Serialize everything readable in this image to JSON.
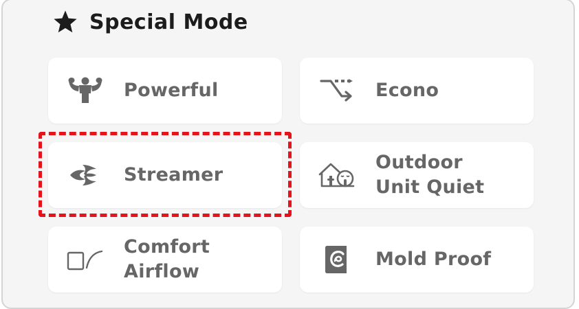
{
  "header": {
    "title": "Special Mode",
    "icon": "star-icon"
  },
  "modes": [
    {
      "id": "powerful",
      "label": "Powerful",
      "icon": "muscle-icon"
    },
    {
      "id": "econo",
      "label": "Econo",
      "icon": "econo-icon"
    },
    {
      "id": "streamer",
      "label": "Streamer",
      "icon": "streamer-icon",
      "focused": true
    },
    {
      "id": "outdoor-unit-quiet",
      "label": "Outdoor\nUnit Quiet",
      "icon": "outdoor-quiet-icon"
    },
    {
      "id": "comfort-airflow",
      "label": "Comfort\nAirflow",
      "icon": "comfort-airflow-icon"
    },
    {
      "id": "mold-proof",
      "label": "Mold Proof",
      "icon": "mold-proof-icon"
    }
  ],
  "colors": {
    "panel_bg": "#f5f5f5",
    "card_bg": "#ffffff",
    "label": "#666666",
    "icon": "#666666",
    "title": "#1c1c1c",
    "focus": "#e5141c"
  }
}
